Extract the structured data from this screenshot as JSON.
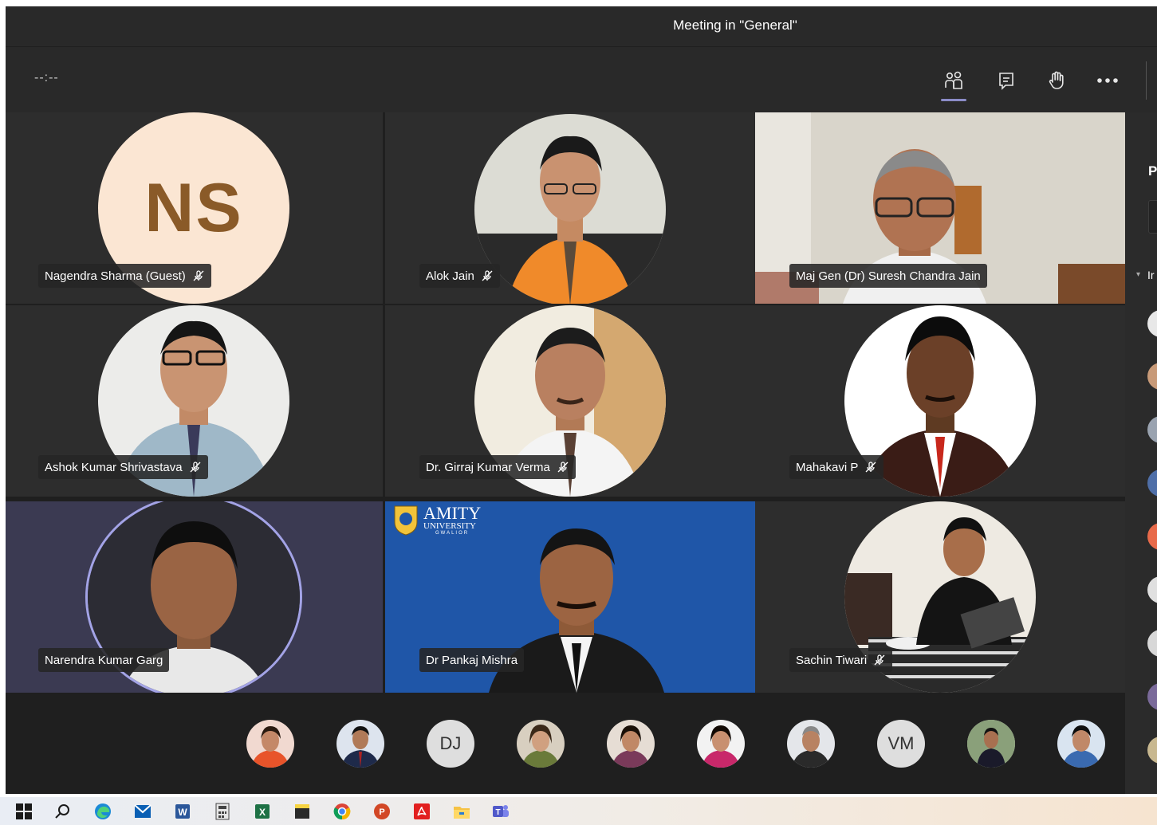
{
  "window": {
    "title": "Meeting in \"General\""
  },
  "toolbar": {
    "timer": "--:--",
    "buttons": [
      {
        "icon": "participants-icon",
        "active": true
      },
      {
        "icon": "chat-icon",
        "active": false
      },
      {
        "icon": "raise-hand-icon",
        "active": false
      },
      {
        "icon": "more-options-icon",
        "active": false
      }
    ]
  },
  "participants": [
    {
      "name": "Nagendra Sharma (Guest)",
      "initials": "NS",
      "muted": true
    },
    {
      "name": "Alok Jain",
      "muted": true
    },
    {
      "name": "Maj Gen (Dr) Suresh Chandra Jain",
      "muted": false
    },
    {
      "name": "Ashok Kumar Shrivastava",
      "muted": true
    },
    {
      "name": "Dr. Girraj Kumar Verma",
      "muted": true
    },
    {
      "name": "Mahakavi P",
      "muted": true
    },
    {
      "name": "Narendra Kumar Garg",
      "muted": false,
      "speaking": true
    },
    {
      "name": "Dr Pankaj Mishra",
      "muted": false
    },
    {
      "name": "Sachin Tiwari",
      "muted": true
    }
  ],
  "video_background": {
    "logo_title": "AMITY",
    "logo_subtitle": "UNIVERSITY",
    "logo_campus": "GWALIOR"
  },
  "side_panel": {
    "heading_partial": "P",
    "section_partial": "Ir"
  },
  "roster": [
    {
      "initials": ""
    },
    {
      "initials": ""
    },
    {
      "initials": "DJ"
    },
    {
      "initials": ""
    },
    {
      "initials": ""
    },
    {
      "initials": ""
    },
    {
      "initials": ""
    },
    {
      "initials": "VM"
    },
    {
      "initials": ""
    },
    {
      "initials": ""
    }
  ],
  "taskbar": {
    "icons": [
      "windows-start-icon",
      "search-icon",
      "edge-icon",
      "mail-icon",
      "word-icon",
      "calculator-icon",
      "excel-icon",
      "sticky-notes-icon",
      "chrome-icon",
      "powerpoint-icon",
      "acrobat-icon",
      "file-explorer-icon",
      "teams-icon"
    ]
  },
  "colors": {
    "accent": "#8b8cc7",
    "background": "#1f1f1f",
    "tile": "#2d2d2d",
    "initials_avatar_bg": "#fbe6d3",
    "initials_text": "#8a5a28",
    "amity_blue": "#1f56a8"
  }
}
